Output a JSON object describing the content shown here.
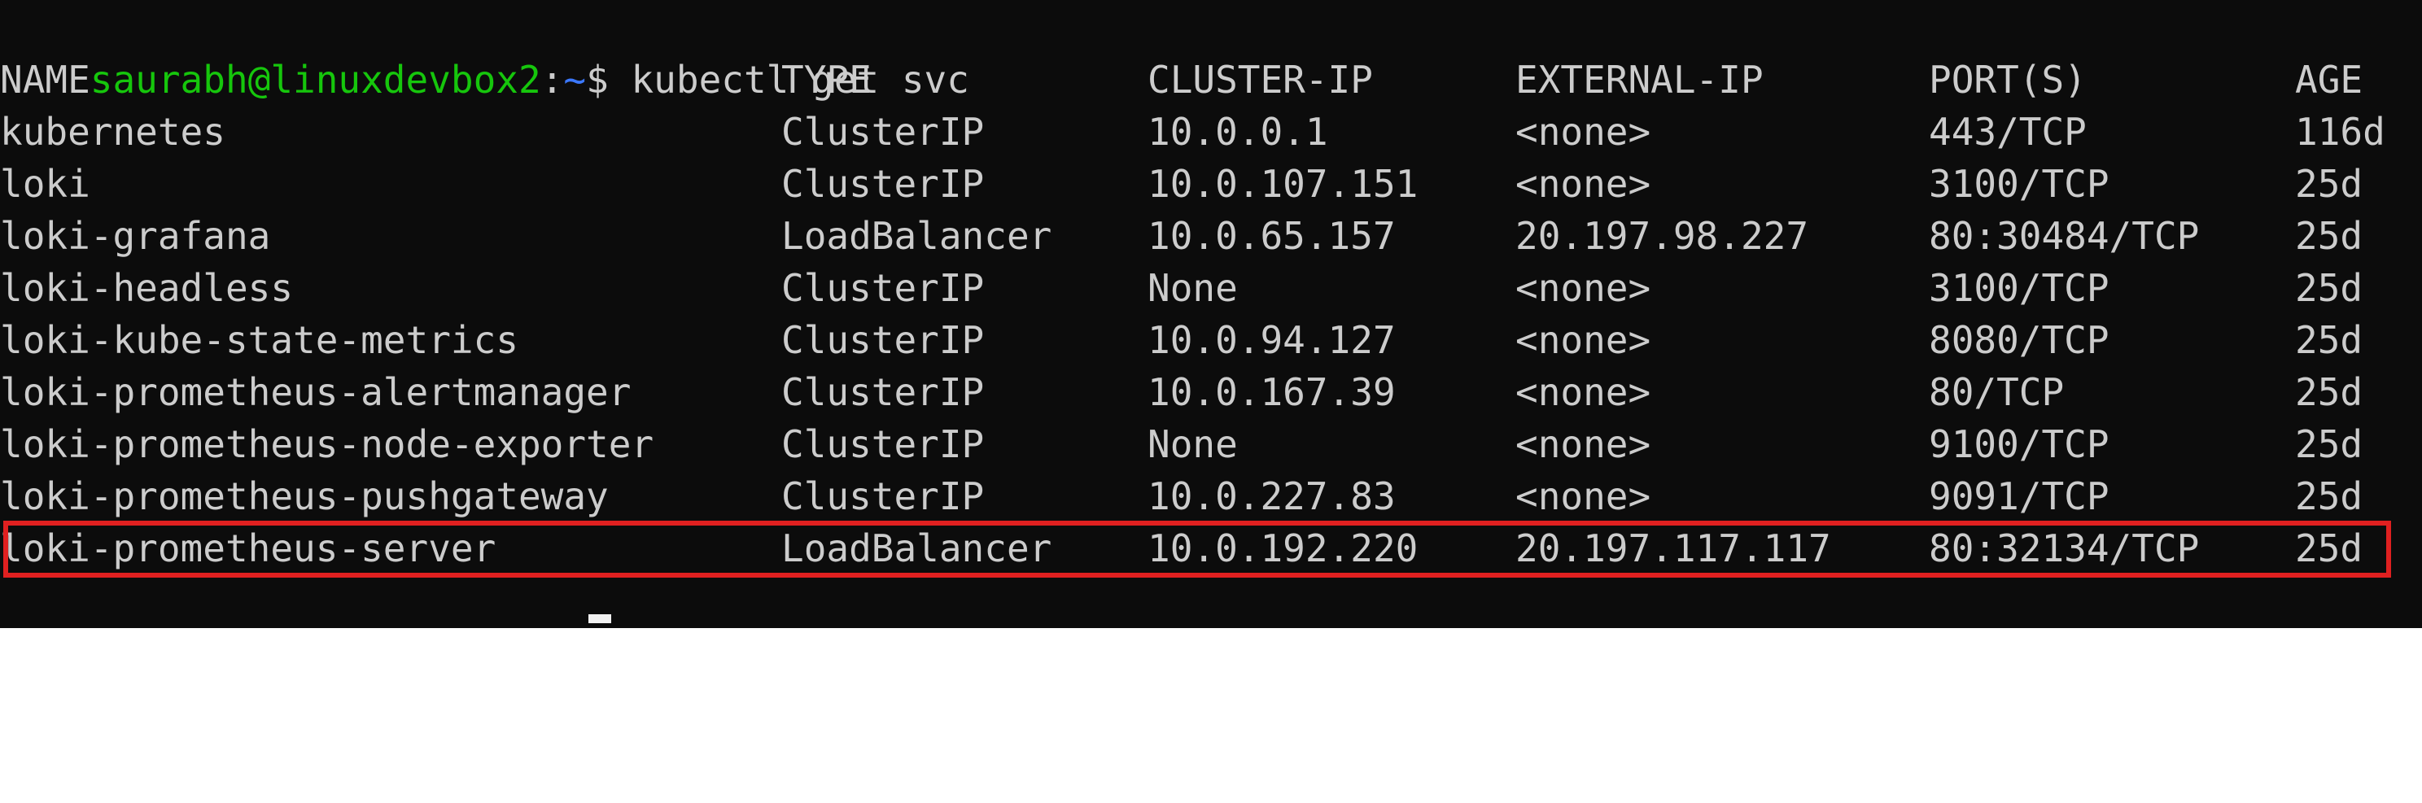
{
  "prompt": {
    "user_host": "saurabh@linuxdevbox2",
    "separator": ":",
    "path": "~",
    "symbol": "$"
  },
  "command": "kubectl get svc",
  "table": {
    "headers": [
      "NAME",
      "TYPE",
      "CLUSTER-IP",
      "EXTERNAL-IP",
      "PORT(S)",
      "AGE"
    ],
    "rows": [
      [
        "kubernetes",
        "ClusterIP",
        "10.0.0.1",
        "<none>",
        "443/TCP",
        "116d"
      ],
      [
        "loki",
        "ClusterIP",
        "10.0.107.151",
        "<none>",
        "3100/TCP",
        "25d"
      ],
      [
        "loki-grafana",
        "LoadBalancer",
        "10.0.65.157",
        "20.197.98.227",
        "80:30484/TCP",
        "25d"
      ],
      [
        "loki-headless",
        "ClusterIP",
        "None",
        "<none>",
        "3100/TCP",
        "25d"
      ],
      [
        "loki-kube-state-metrics",
        "ClusterIP",
        "10.0.94.127",
        "<none>",
        "8080/TCP",
        "25d"
      ],
      [
        "loki-prometheus-alertmanager",
        "ClusterIP",
        "10.0.167.39",
        "<none>",
        "80/TCP",
        "25d"
      ],
      [
        "loki-prometheus-node-exporter",
        "ClusterIP",
        "None",
        "<none>",
        "9100/TCP",
        "25d"
      ],
      [
        "loki-prometheus-pushgateway",
        "ClusterIP",
        "10.0.227.83",
        "<none>",
        "9091/TCP",
        "25d"
      ],
      [
        "loki-prometheus-server",
        "LoadBalancer",
        "10.0.192.220",
        "20.197.117.117",
        "80:32134/TCP",
        "25d"
      ]
    ],
    "highlighted_row": "loki-prometheus-server"
  },
  "colors": {
    "background": "#0c0c0c",
    "text": "#cccccc",
    "prompt_user": "#16c60c",
    "prompt_path": "#3b78ff",
    "highlight_border": "#e02020"
  }
}
